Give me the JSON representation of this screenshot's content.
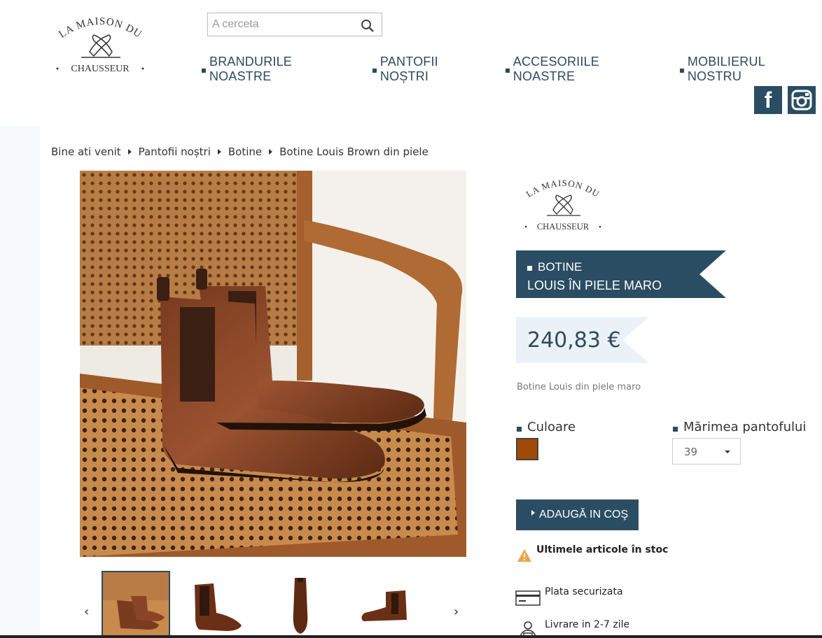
{
  "header": {
    "logo": {
      "line1": "LA MAISON DU",
      "line2": "CHAUSSEUR"
    },
    "search": {
      "placeholder": "A cerceta",
      "icon": "search-icon"
    },
    "nav": [
      {
        "label": "BRANDURILE NOASTRE"
      },
      {
        "label": "PANTOFII NOȘTRI"
      },
      {
        "label": "ACCESORIILE NOASTRE"
      },
      {
        "label": "MOBILIERUL NOSTRU"
      }
    ],
    "social": [
      {
        "name": "facebook-icon",
        "glyph": "f"
      },
      {
        "name": "instagram-icon"
      }
    ]
  },
  "breadcrumb": [
    {
      "label": "Bine ati venit"
    },
    {
      "label": "Pantofii noștri"
    },
    {
      "label": "Botine"
    },
    {
      "label": "Botine Louis Brown din piele"
    }
  ],
  "product": {
    "brand_logo": {
      "line1": "LA MAISON DU",
      "line2": "CHAUSSEUR"
    },
    "title_line1": "BOTINE",
    "title_line2": "LOUIS ÎN PIELE MARO",
    "price": "240,83 €",
    "short_description": "Botine Louis din piele maro",
    "color_label": "Culoare",
    "color_value": "#a04a06",
    "size_label": "Mărimea pantofului",
    "size_value": "39",
    "add_to_cart": "ADAUGĂ IN COŞ",
    "stock_notice": "Ultimele articole în stoc",
    "reassurance": [
      {
        "label": "Plata securizata",
        "icon": "credit-card-icon"
      },
      {
        "label": "Livrare in 2-7 zile",
        "icon": "delivery-person-icon"
      }
    ],
    "thumbnails": [
      {
        "name": "boots-on-chair"
      },
      {
        "name": "boot-side-view"
      },
      {
        "name": "boot-front-view"
      },
      {
        "name": "boot-profile-view"
      }
    ]
  },
  "colors": {
    "brand_dark": "#2a4d63",
    "price_bg": "#eaf2f7",
    "swatch_brown": "#a04a06"
  }
}
